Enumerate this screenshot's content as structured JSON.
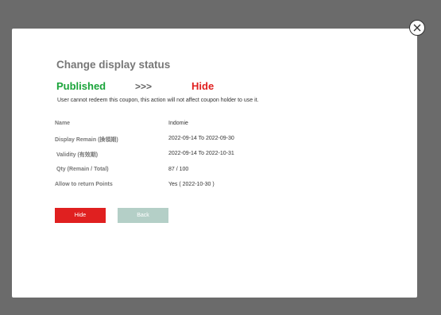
{
  "dialog": {
    "title": "Change display status",
    "status_from": "Published",
    "arrow": ">>>",
    "status_to": "Hide",
    "note": "User cannot redeem this coupon, this action will not affect coupon holder to use it.",
    "fields": [
      {
        "label": "Name",
        "value": "Indomie"
      },
      {
        "label": "Display Remain (換領期)",
        "value": "2022-09-14 To 2022-09-30"
      },
      {
        "label": "Validity (有效期)",
        "value": "2022-09-14 To 2022-10-31"
      },
      {
        "label": "Qty  (Remain / Total)",
        "value": "87 / 100"
      },
      {
        "label": "Allow to return Points",
        "value": "Yes ( 2022-10-30 )"
      }
    ],
    "hide_button": "Hide",
    "back_button": "Back"
  },
  "colors": {
    "overlay": "#6b6b6b",
    "published": "#1aa43a",
    "hide": "#e02020",
    "back_button": "#b4cfc7"
  },
  "icons": {
    "close": "close-icon"
  }
}
